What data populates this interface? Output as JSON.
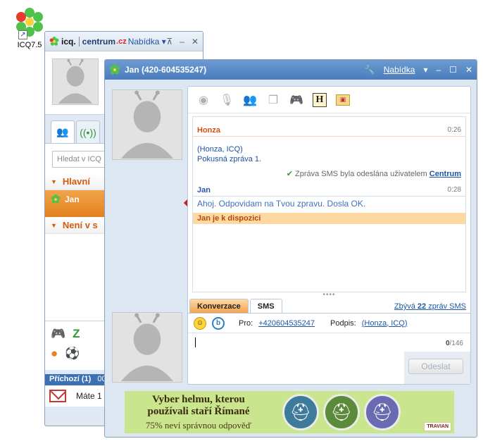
{
  "desktop": {
    "icon_label": "ICQ7.5",
    "shortcut_arrow": "↗"
  },
  "main_window": {
    "brand_icq": "icq.",
    "brand_centrum": "centrum",
    "brand_cz": ".cz",
    "menu_label": "Nabídka ▾",
    "search_placeholder": "Hledat v ICQ",
    "groups": [
      {
        "name": "Hlavní"
      },
      {
        "name": "Není v s"
      }
    ],
    "contact": {
      "name": "Jan"
    },
    "incoming_label": "Příchozí (1)",
    "incoming_count_fragment": "00:",
    "mail_preview": "Máte 1"
  },
  "chat_window": {
    "title": "Jan (420-604535247)",
    "menu_label": "Nabídka",
    "messages": {
      "honza": {
        "sender": "Honza",
        "time": "0:26",
        "line1": "(Honza, ICQ)",
        "line2": "Pokusná zpráva 1."
      },
      "sms_note": {
        "text": "Zpráva SMS byla odeslána uživatelem",
        "link": "Centrum"
      },
      "jan": {
        "sender": "Jan",
        "time": "0:28",
        "text": "Ahoj. Odpovidam na Tvou zpravu. Dosla OK."
      },
      "status": "Jan je k dispozici"
    },
    "tabs": {
      "konverzace": "Konverzace",
      "sms": "SMS"
    },
    "remaining": {
      "prefix": "Zbývá",
      "count": "22",
      "suffix": "zpráv SMS"
    },
    "to_label": "Pro:",
    "to_number": "+420604535247",
    "signature_label": "Podpis:",
    "signature_value": "(Honza, ICQ)",
    "counter": {
      "current": "0",
      "max": "/146"
    },
    "send_label": "Odeslat"
  },
  "ad": {
    "line1": "Vyber helmu, kterou",
    "line2": "používali staří Římané",
    "line3": "75% neví správnou odpověď",
    "brand": "TRAVIAN"
  },
  "colors": {
    "orange": "#e3801f",
    "blue_link": "#1d56a8",
    "title_blue": "#4a7cbd"
  }
}
